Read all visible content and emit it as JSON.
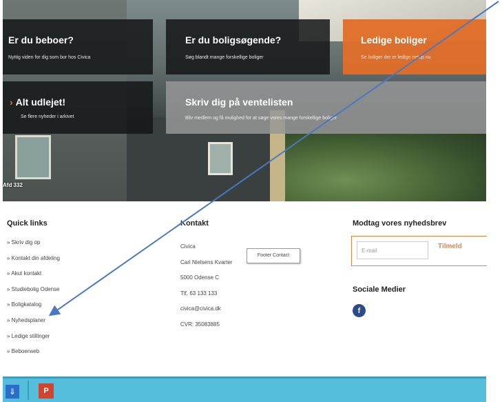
{
  "hero": {
    "tiles": {
      "beboer": {
        "title": "Er du beboer?",
        "sub": "Nyttig viden for dig som bor hos Civica"
      },
      "boligsog": {
        "title": "Er du boligsøgende?",
        "sub": "Søg blandt mange forskellige boliger"
      },
      "ledige": {
        "title": "Ledige boliger",
        "sub": "Se boliger der er ledige netop nu"
      },
      "udlejet": {
        "title": "Alt udlejet!",
        "sub": "Se flere nyheder i arkivet"
      },
      "venteliste": {
        "title": "Skriv dig på ventelisten",
        "sub": "Bliv medlem og få mulighed for at søge vores mange forskellige boliger"
      }
    },
    "caption": "Afd 332"
  },
  "quick_links": {
    "title": "Quick links",
    "items": [
      "» Skriv dig op",
      "» Kontakt din afdeling",
      "» Akut kontakt",
      "» Studiebolig Odense",
      "» Boligkatalog",
      "» Nyhedsplaner",
      "» Ledige stillinger",
      "» Beboerweb"
    ]
  },
  "kontakt": {
    "title": "Kontakt",
    "lines": [
      "Civica",
      "Carl Nielsens Kvarter",
      "5000 Odense C",
      "Tlf. 63 133 133",
      "civica@civica.dk",
      "CVR: 35083885"
    ],
    "tooltip": "Footer Contact"
  },
  "newsletter": {
    "title": "Modtag vores nyhedsbrev",
    "placeholder": "E-mail",
    "button": "Tilmeld"
  },
  "social": {
    "title": "Sociale Medier",
    "facebook": "f"
  },
  "taskbar": {
    "icon1": "dropbox-icon",
    "icon2": "powerpoint-icon",
    "icon2_label": "P"
  },
  "colors": {
    "accent": "#e0854a",
    "taskbar": "#55bedd",
    "annotation": "#4a78c0"
  }
}
